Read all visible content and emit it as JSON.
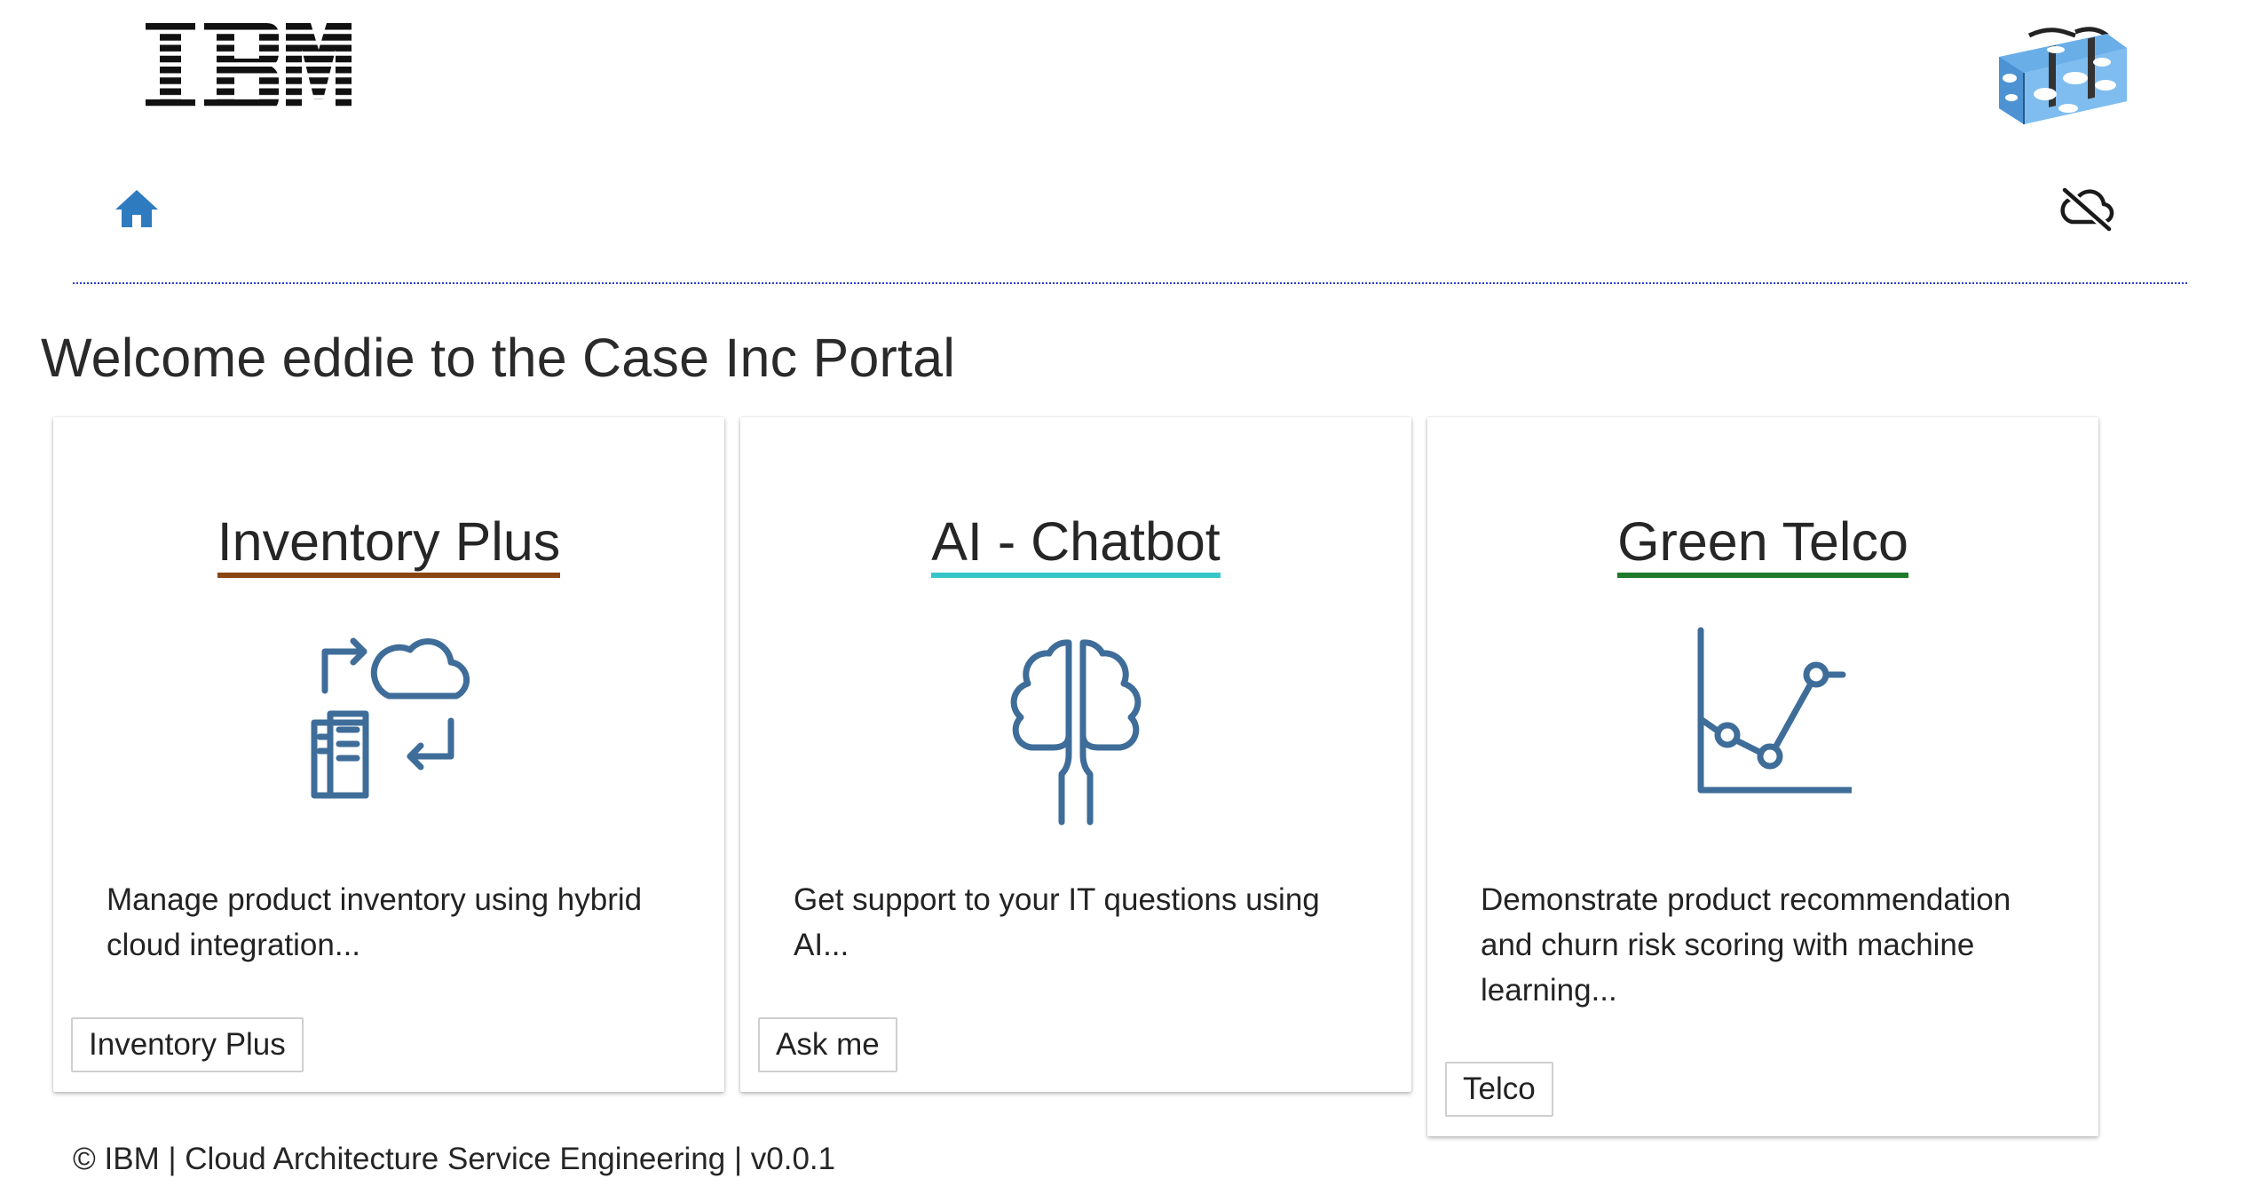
{
  "header": {
    "logo_text": "IBM",
    "home_icon": "home-icon",
    "cloud_status_icon": "cloud-offline-icon",
    "suitcase_image": "cloud-pattern-suitcase"
  },
  "welcome": {
    "prefix": "Welcome ",
    "username": "eddie",
    "suffix": " to the Case Inc Portal"
  },
  "cards": [
    {
      "title": "Inventory Plus",
      "accent": "#8b4513",
      "icon": "hybrid-cloud-integration-icon",
      "description": "Manage product inventory using hybrid cloud integration...",
      "button_label": "Inventory Plus"
    },
    {
      "title": "AI - Chatbot",
      "accent": "#36c6c9",
      "icon": "brain-tree-icon",
      "description": "Get support to your IT questions using AI...",
      "button_label": "Ask me"
    },
    {
      "title": "Green Telco",
      "accent": "#1f7a2a",
      "icon": "line-chart-icon",
      "description": "Demonstrate product recommendation and churn risk scoring with machine learning...",
      "button_label": "Telco"
    }
  ],
  "footer": {
    "text": "© IBM | Cloud Architecture Service Engineering | v0.0.1"
  },
  "colors": {
    "icon_blue": "#3f6d99",
    "home_blue": "#2f7bbf",
    "divider": "#2b3fd0"
  }
}
